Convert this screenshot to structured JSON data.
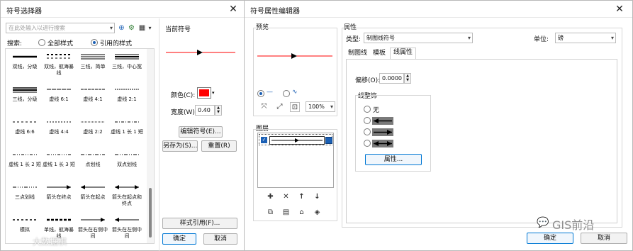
{
  "selector": {
    "title": "符号选择器",
    "search_placeholder": "在此处输入以进行搜索",
    "search_label": "搜索:",
    "radio_all": "全部样式",
    "radio_ref": "引用的样式",
    "symbols": [
      {
        "label": "双线，分级"
      },
      {
        "label": "双线，航海暴线"
      },
      {
        "label": "三线，简单"
      },
      {
        "label": "三线，中心宽"
      },
      {
        "label": "三线，分级"
      },
      {
        "label": "虚线 6:1"
      },
      {
        "label": "虚线 4:1"
      },
      {
        "label": "虚线 2:1"
      },
      {
        "label": "虚线 6:6"
      },
      {
        "label": "虚线 4:4"
      },
      {
        "label": "虚线 2:2"
      },
      {
        "label": "虚线 1 长 1 短"
      },
      {
        "label": "虚线 1 长 2 短"
      },
      {
        "label": "虚线 1 长 3 短"
      },
      {
        "label": "点划线"
      },
      {
        "label": "双点划线"
      },
      {
        "label": "三点划线"
      },
      {
        "label": "箭头在终点"
      },
      {
        "label": "箭头在起点"
      },
      {
        "label": "箭头在起点和终点"
      },
      {
        "label": "模拟"
      },
      {
        "label": "单线，航海暴线"
      },
      {
        "label": "箭头在右侧中间"
      },
      {
        "label": "箭头在左侧中间"
      }
    ],
    "current_symbol_label": "当前符号",
    "color_label": "颜色(C):",
    "color_value": "#ff0000",
    "width_label": "宽度(W):",
    "width_value": "0.40",
    "edit_button": "编辑符号(E)...",
    "save_as_button": "另存为(S)...",
    "reset_button": "重置(R)",
    "style_ref_button": "样式引用(F)...",
    "ok_button": "确定",
    "cancel_button": "取消",
    "watermark": "大数据棋"
  },
  "editor": {
    "title": "符号属性编辑器",
    "preview_label": "预览",
    "zoom_value": "100%",
    "layers_label": "图层",
    "properties_label": "属性",
    "type_label": "类型:",
    "type_value": "制图线符号",
    "unit_label": "单位:",
    "unit_value": "磅",
    "tabs": [
      "制图线",
      "模板",
      "线属性"
    ],
    "offset_label": "偏移(O):",
    "offset_value": "0.0000",
    "decoration_label": "线整饰",
    "decoration_none": "无",
    "properties_button": "属性...",
    "ok_button": "确定",
    "cancel_button": "取消",
    "watermark": "GIS前沿"
  }
}
